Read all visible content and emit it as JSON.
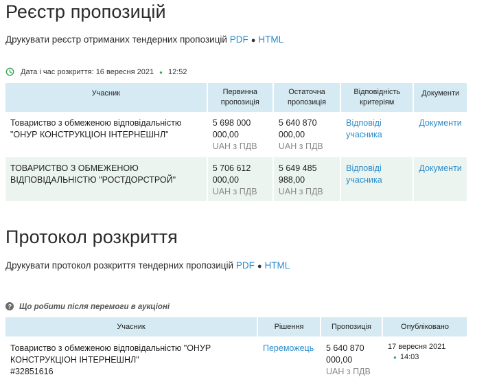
{
  "registry": {
    "title": "Реєстр пропозицій",
    "print_text": "Друкувати реєстр отриманих тендерних пропозицій",
    "pdf_label": "PDF",
    "html_label": "HTML",
    "separator": "●",
    "opening_label": "Дата і час розкриття: 16 вересня 2021",
    "opening_time": "12:52",
    "headers": {
      "participant": "Учасник",
      "initial": "Первинна пропозиція",
      "final": "Остаточна пропозиція",
      "criteria": "Відповідність критеріям",
      "documents": "Документи"
    },
    "rows": [
      {
        "participant": "Товариство з обмеженою відповідальністю \"ОНУР КОНСТРУКЦІОН ІНТЕРНЕШНЛ\"",
        "initial_amount": "5 698 000 000,00",
        "initial_currency": "UAH з ПДВ",
        "final_amount": "5 640 870 000,00",
        "final_currency": "UAH з ПДВ",
        "criteria_link": "Відповіді учасника",
        "documents_link": "Документи"
      },
      {
        "participant": "ТОВАРИСТВО З ОБМЕЖЕНОЮ ВІДПОВІДАЛЬНІСТЮ \"РОСТДОРСТРОЙ\"",
        "initial_amount": "5 706 612 000,00",
        "initial_currency": "UAH з ПДВ",
        "final_amount": "5 649 485 988,00",
        "final_currency": "UAH з ПДВ",
        "criteria_link": "Відповіді учасника",
        "documents_link": "Документи"
      }
    ]
  },
  "protocol": {
    "title": "Протокол розкриття",
    "print_text": "Друкувати протокол розкриття тендерних пропозицій",
    "pdf_label": "PDF",
    "html_label": "HTML",
    "separator": "●",
    "help_text": "Що робити після перемоги в аукціоні",
    "headers": {
      "participant": "Учасник",
      "decision": "Рішення",
      "offer": "Пропозиція",
      "published": "Опубліковано"
    },
    "rows": [
      {
        "participant": "Товариство з обмеженою відповідальністю \"ОНУР КОНСТРУКЦІОН ІНТЕРНЕШНЛ\"",
        "code": "#32851616",
        "decision": "Переможець",
        "offer_amount": "5 640 870 000,00",
        "offer_currency": "UAH з ПДВ",
        "published_date": "17 вересня 2021",
        "published_time": "14:03"
      }
    ]
  },
  "colors": {
    "link": "#2b8ccb",
    "header_bg": "#d5eaf2",
    "row_alt_bg": "#ebf4ef",
    "accent_green": "#3aa757"
  },
  "icons": {
    "clock": "clock-icon",
    "help": "question-circle-icon"
  }
}
